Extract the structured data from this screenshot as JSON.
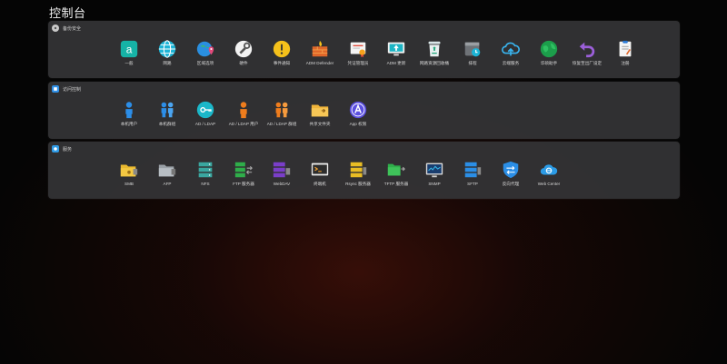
{
  "page_title": "控制台",
  "colors": {
    "background": "#050505",
    "panel": "#343436",
    "glow": "#5f160a"
  },
  "panels": [
    {
      "title": "备份安全",
      "icon": "gear-icon",
      "items": [
        {
          "label": "一般",
          "icon": "general-icon"
        },
        {
          "label": "网路",
          "icon": "globe-icon"
        },
        {
          "label": "区域选项",
          "icon": "region-icon"
        },
        {
          "label": "硬件",
          "icon": "hardware-icon"
        },
        {
          "label": "事件通知",
          "icon": "alert-icon"
        },
        {
          "label": "ADM Defender",
          "icon": "firewall-icon"
        },
        {
          "label": "凭证管理员",
          "icon": "certificate-icon"
        },
        {
          "label": "ADM 更新",
          "icon": "update-icon"
        },
        {
          "label": "网路资源回收桶",
          "icon": "recycle-bin-icon"
        },
        {
          "label": "排程",
          "icon": "schedule-icon"
        },
        {
          "label": "云端服务",
          "icon": "cloud-icon"
        },
        {
          "label": "华硕助手",
          "icon": "earth-icon"
        },
        {
          "label": "恢复至出厂设定",
          "icon": "reset-icon"
        },
        {
          "label": "注册",
          "icon": "registration-icon"
        }
      ]
    },
    {
      "title": "访问控制",
      "icon": "access-control-icon",
      "items": [
        {
          "label": "本机用户",
          "icon": "user-icon"
        },
        {
          "label": "本机群组",
          "icon": "group-icon"
        },
        {
          "label": "AD / LDAP",
          "icon": "key-icon"
        },
        {
          "label": "AD / LDAP 用户",
          "icon": "ldap-user-icon"
        },
        {
          "label": "AD / LDAP 群组",
          "icon": "ldap-group-icon"
        },
        {
          "label": "共享文件夹",
          "icon": "shared-folder-icon"
        },
        {
          "label": "App 权限",
          "icon": "app-permission-icon"
        }
      ]
    },
    {
      "title": "服务",
      "icon": "services-icon",
      "items": [
        {
          "label": "SMB",
          "icon": "smb-folder-icon"
        },
        {
          "label": "AFP",
          "icon": "afp-folder-icon"
        },
        {
          "label": "NFS",
          "icon": "nfs-server-icon"
        },
        {
          "label": "FTP 服务器",
          "icon": "ftp-server-icon"
        },
        {
          "label": "WebDAV",
          "icon": "webdav-server-icon"
        },
        {
          "label": "终端机",
          "icon": "terminal-icon"
        },
        {
          "label": "Rsync 服务器",
          "icon": "rsync-server-icon"
        },
        {
          "label": "TFTP 服务器",
          "icon": "tftp-server-icon"
        },
        {
          "label": "SNMP",
          "icon": "snmp-monitor-icon"
        },
        {
          "label": "SFTP",
          "icon": "sftp-server-icon"
        },
        {
          "label": "反向代理",
          "icon": "reverse-proxy-icon"
        },
        {
          "label": "Web Center",
          "icon": "web-center-icon"
        }
      ]
    }
  ]
}
